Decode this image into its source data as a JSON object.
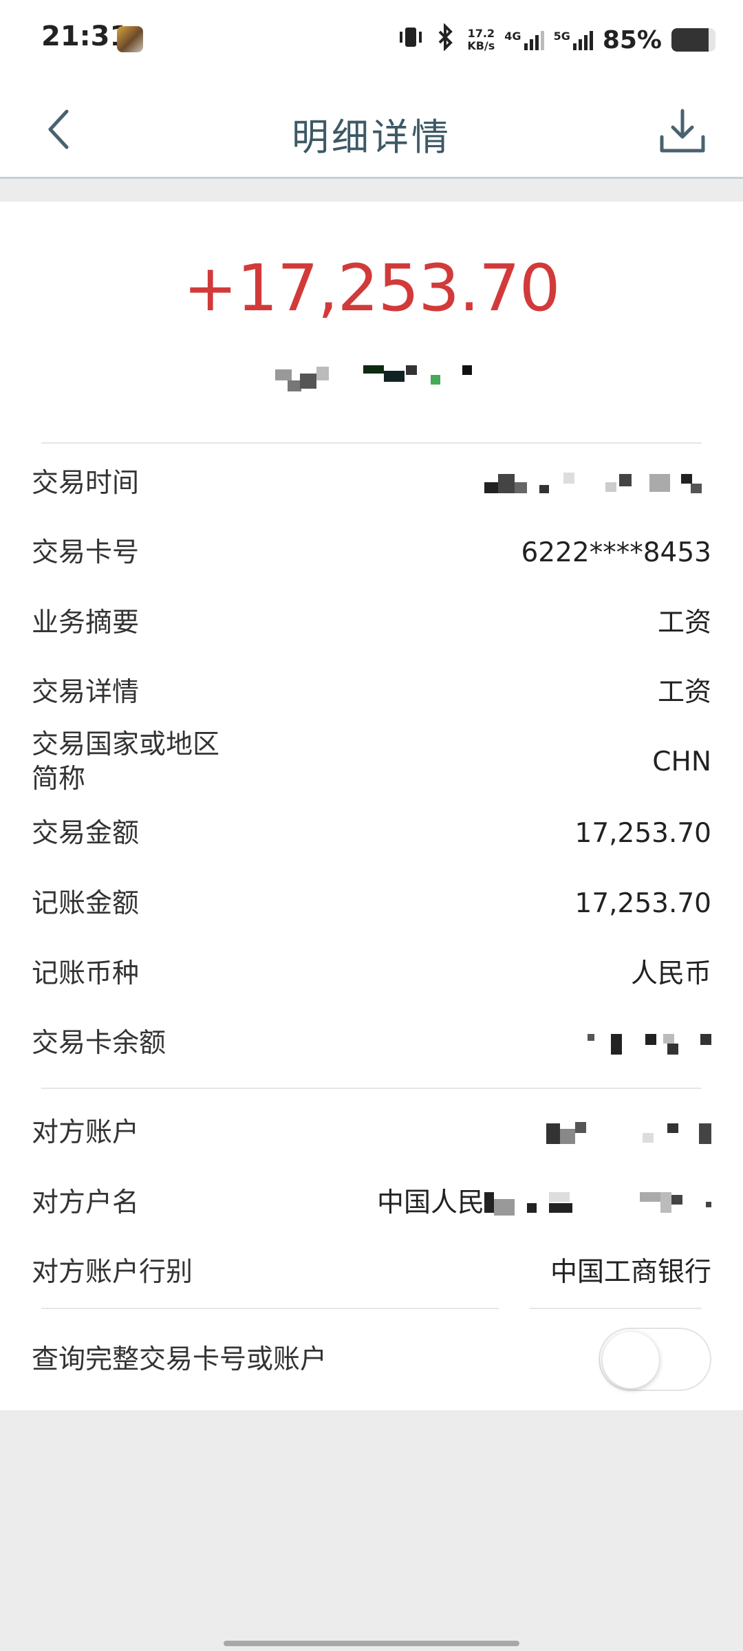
{
  "status_bar": {
    "time": "21:31",
    "net_speed_value": "17.2",
    "net_speed_unit": "KB/s",
    "net_4g": "4G",
    "net_5g": "5G",
    "battery": "85%",
    "battery_level": 0.85,
    "icons": [
      "vibrate-icon",
      "bluetooth-icon",
      "signal-icon",
      "battery-icon"
    ]
  },
  "header": {
    "title": "明细详情"
  },
  "transaction": {
    "amount": "+17,253.70",
    "amount_color": "#d23a3a"
  },
  "details": [
    {
      "label": "交易时间",
      "value": null
    },
    {
      "label": "交易卡号",
      "value": "6222****8453"
    },
    {
      "label": "业务摘要",
      "value": "工资"
    },
    {
      "label": "交易详情",
      "value": "工资"
    },
    {
      "label_line1": "交易国家或地区",
      "label_line2": "简称",
      "value": "CHN"
    },
    {
      "label": "交易金额",
      "value": "17,253.70"
    },
    {
      "label": "记账金额",
      "value": "17,253.70"
    },
    {
      "label": "记账币种",
      "value": "人民币"
    },
    {
      "label": "交易卡余额",
      "value": null
    }
  ],
  "counterparty": [
    {
      "label": "对方账户",
      "value": null
    },
    {
      "label": "对方户名",
      "value_prefix": "中国人民"
    },
    {
      "label": "对方账户行别",
      "value": "中国工商银行"
    }
  ],
  "toggle": {
    "label": "查询完整交易卡号或账户",
    "state": "off"
  }
}
